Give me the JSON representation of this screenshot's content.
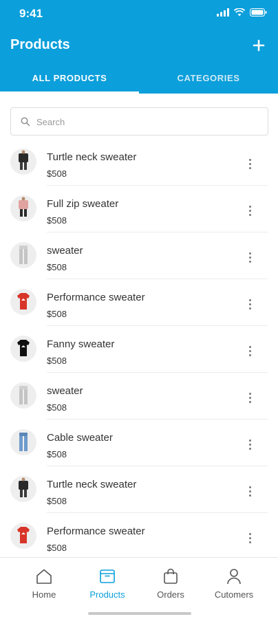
{
  "status": {
    "time": "9:41"
  },
  "header": {
    "title": "Products",
    "add_icon": "plus-icon"
  },
  "tabs": [
    {
      "label": "ALL PRODUCTS",
      "active": true
    },
    {
      "label": "CATEGORIES",
      "active": false
    }
  ],
  "search": {
    "placeholder": "Search"
  },
  "products": [
    {
      "name": "Turtle neck sweater",
      "price": "$508",
      "image": "black-jacket"
    },
    {
      "name": "Full zip sweater",
      "price": "$508",
      "image": "pink-top"
    },
    {
      "name": "sweater",
      "price": "$508",
      "image": "grey-pants"
    },
    {
      "name": "Performance sweater",
      "price": "$508",
      "image": "red-shirt"
    },
    {
      "name": "Fanny sweater",
      "price": "$508",
      "image": "black-shirt"
    },
    {
      "name": "sweater",
      "price": "$508",
      "image": "grey-pants"
    },
    {
      "name": "Cable sweater",
      "price": "$508",
      "image": "blue-jeans"
    },
    {
      "name": "Turtle neck sweater",
      "price": "$508",
      "image": "black-jacket"
    },
    {
      "name": "Performance sweater",
      "price": "$508",
      "image": "red-shirt"
    }
  ],
  "nav": [
    {
      "label": "Home",
      "icon": "home-icon",
      "active": false
    },
    {
      "label": "Products",
      "icon": "box-icon",
      "active": true
    },
    {
      "label": "Orders",
      "icon": "bag-icon",
      "active": false
    },
    {
      "label": "Cutomers",
      "icon": "user-icon",
      "active": false
    }
  ],
  "colors": {
    "primary": "#0b9fdb",
    "text": "#333333"
  }
}
